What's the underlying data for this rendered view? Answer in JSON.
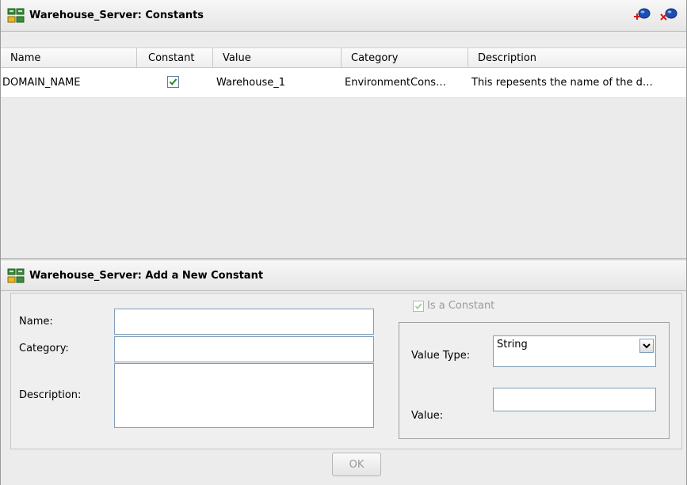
{
  "constants_panel": {
    "title": "Warehouse_Server: Constants",
    "icon": "server-group-icon",
    "add_button_icon": "add-constant-icon",
    "delete_button_icon": "delete-constant-icon"
  },
  "table": {
    "columns": [
      "Name",
      "Constant",
      "Value",
      "Category",
      "Description"
    ],
    "rows": [
      {
        "name": "DOMAIN_NAME",
        "constant": true,
        "value": "Warehouse_1",
        "category": "EnvironmentCons…",
        "description": "This repesents the name of the d…"
      }
    ]
  },
  "add_panel": {
    "title": "Warehouse_Server: Add a New Constant",
    "icon": "server-group-icon",
    "name_label": "Name:",
    "name_value": "",
    "category_label": "Category:",
    "category_value": "",
    "description_label": "Description:",
    "description_value": "",
    "is_constant_label": "Is a Constant",
    "is_constant_checked": true,
    "is_constant_disabled": true,
    "value_type_label": "Value Type:",
    "value_type_selected": "String",
    "value_label": "Value:",
    "value_value": "",
    "ok_label": "OK"
  },
  "colors": {
    "check_green": "#1f8a1f",
    "disabled_text": "#9a9a9a",
    "input_border": "#7f9db9"
  }
}
